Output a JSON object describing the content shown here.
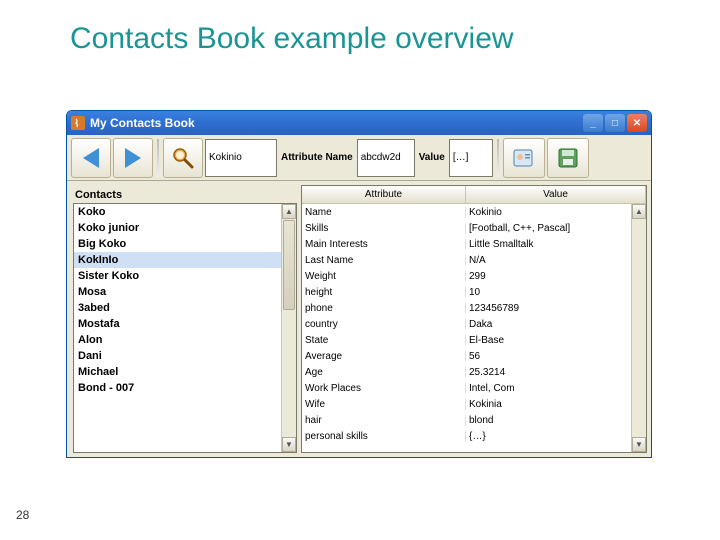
{
  "slide": {
    "title": "Contacts Book example overview",
    "number": "28"
  },
  "window": {
    "title": "My Contacts Book"
  },
  "toolbar": {
    "name_value": "Kokinio",
    "attr_label": "Attribute Name",
    "attr_value": "abcdw2d",
    "value_label": "Value",
    "value_value": "[…]"
  },
  "contacts": {
    "header": "Contacts",
    "items": [
      "Koko",
      "Koko junior",
      "Big Koko",
      "KokInIo",
      "Sister Koko",
      "Mosa",
      "3abed",
      "Mostafa",
      "Alon",
      "Dani",
      "Michael",
      "Bond - 007"
    ],
    "selected_index": 3
  },
  "table": {
    "headers": {
      "attr": "Attribute",
      "val": "Value"
    },
    "rows": [
      {
        "attr": "Name",
        "val": "Kokinio"
      },
      {
        "attr": "Skills",
        "val": "[Football, C++, Pascal]"
      },
      {
        "attr": "Main Interests",
        "val": "Little Smalltalk"
      },
      {
        "attr": "Last Name",
        "val": "N/A"
      },
      {
        "attr": "Weight",
        "val": "299"
      },
      {
        "attr": "height",
        "val": "10"
      },
      {
        "attr": "phone",
        "val": "123456789"
      },
      {
        "attr": "country",
        "val": "Daka"
      },
      {
        "attr": "State",
        "val": "El-Base"
      },
      {
        "attr": "Average",
        "val": "56"
      },
      {
        "attr": "Age",
        "val": "25.3214"
      },
      {
        "attr": "Work Places",
        "val": "Intel, Com"
      },
      {
        "attr": "Wife",
        "val": "Kokinia"
      },
      {
        "attr": "hair",
        "val": "blond"
      },
      {
        "attr": "personal skills",
        "val": "{…}"
      }
    ]
  }
}
